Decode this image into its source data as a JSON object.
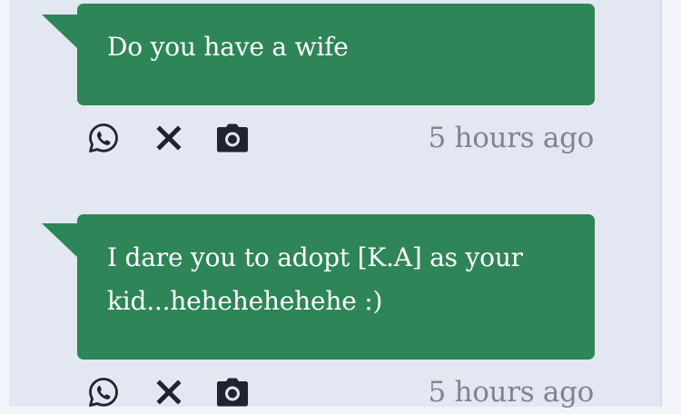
{
  "messages": [
    {
      "text": "Do you have a wife",
      "time": "5 hours ago",
      "icons": [
        "whatsapp-icon",
        "close-icon",
        "camera-icon"
      ]
    },
    {
      "text": "I dare you to adopt [K.A] as your kid...hehehehehehe :)",
      "time": "5 hours ago",
      "icons": [
        "whatsapp-icon",
        "close-icon",
        "camera-icon"
      ]
    }
  ],
  "colors": {
    "bubble": "#2e8558",
    "bubble_text": "#ffffff",
    "panel_bg": "#e3e7f1",
    "timestamp": "#7d8495",
    "icon": "#1f2430"
  }
}
